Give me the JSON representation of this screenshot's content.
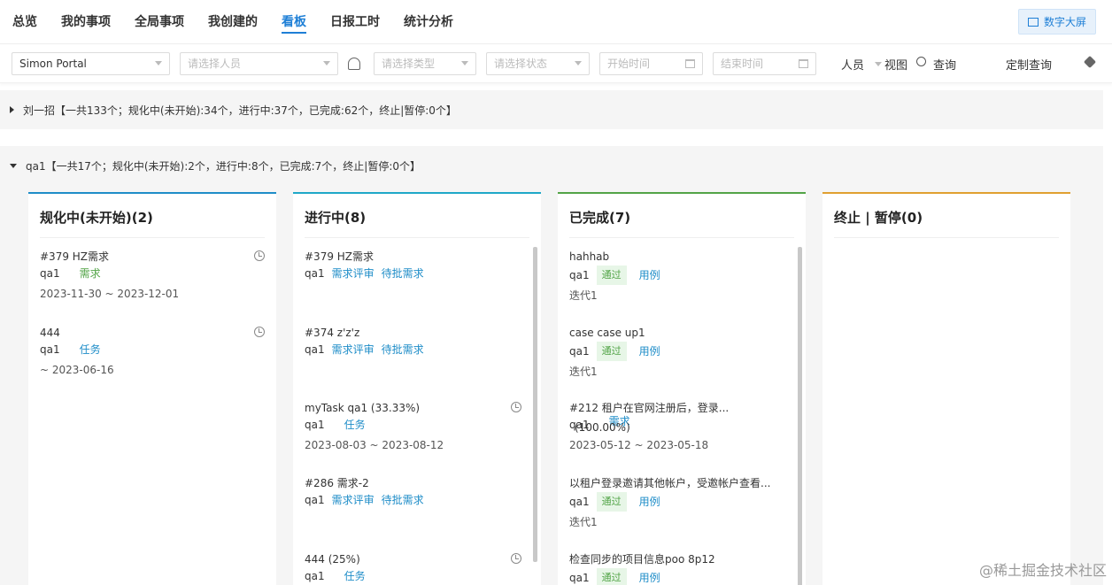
{
  "nav": {
    "tabs": [
      "总览",
      "我的事项",
      "全局事项",
      "我创建的",
      "看板",
      "日报工时",
      "统计分析"
    ],
    "big_screen": "数字大屏"
  },
  "filters": {
    "project": "Simon Portal",
    "person_placeholder": "请选择人员",
    "type_placeholder": "请选择类型",
    "status_placeholder": "请选择状态",
    "start_placeholder": "开始时间",
    "end_placeholder": "结束时间",
    "person_label": "人员",
    "view_label": "视图",
    "query_label": "查询",
    "custom_query": "定制查询"
  },
  "groups": [
    {
      "title": "刘一招【一共133个；规化中(未开始):34个，进行中:37个，已完成:62个，终止|暂停:0个】"
    },
    {
      "title": "qa1【一共17个；规化中(未开始):2个，进行中:8个，已完成:7个，终止|暂停:0个】"
    }
  ],
  "columns": [
    {
      "title": "规化中(未开始)(2)",
      "color": "#1f8dc8",
      "cards": [
        {
          "title": "#379 HZ需求",
          "owner": "qa1",
          "tags": [
            "需求"
          ],
          "date": "2023-11-30 ~ 2023-12-01",
          "clock": true
        },
        {
          "title": "444",
          "owner": "qa1",
          "tags": [
            "任务"
          ],
          "date": "~ 2023-06-16",
          "clock": true
        }
      ]
    },
    {
      "title": "进行中(8)",
      "color": "#1fa8c8",
      "cards": [
        {
          "title": "#379 HZ需求",
          "owner": "qa1",
          "tags": [
            "需求评审",
            "待批需求"
          ]
        },
        {
          "title": "#374 z'z'z",
          "owner": "qa1",
          "tags": [
            "需求评审",
            "待批需求"
          ]
        },
        {
          "title": "myTask qa1  (33.33%)",
          "owner": "qa1",
          "tags": [
            "任务"
          ],
          "date": "2023-08-03 ~ 2023-08-12",
          "clock": true
        },
        {
          "title": "#286 需求-2",
          "owner": "qa1",
          "tags": [
            "需求评审",
            "待批需求"
          ]
        },
        {
          "title": "444  (25%)",
          "owner": "qa1",
          "tags": [
            "任务"
          ],
          "clock": true
        }
      ]
    },
    {
      "title": "已完成(7)",
      "color": "#52a447",
      "cards": [
        {
          "title": "hahhab",
          "owner": "qa1",
          "badge": "通过",
          "tags": [
            "用例"
          ],
          "sub": "迭代1"
        },
        {
          "title": "case case up1",
          "owner": "qa1",
          "badge": "通过",
          "tags": [
            "用例"
          ],
          "sub": "迭代1"
        },
        {
          "title": "#212 租户在官网注册后，登录...",
          "owner": "qa1",
          "overlap": "(100.00%)",
          "tags": [
            "需求"
          ],
          "date": "2023-05-12 ~ 2023-05-18"
        },
        {
          "title": "以租户登录邀请其他帐户，受邀帐户查看...",
          "owner": "qa1",
          "badge": "通过",
          "tags": [
            "用例"
          ],
          "sub": "迭代1"
        },
        {
          "title": "检查同步的项目信息poo 8p12",
          "owner": "qa1",
          "badge": "通过",
          "tags": [
            "用例"
          ]
        }
      ]
    },
    {
      "title": "终止 | 暂停(0)",
      "color": "#e0a030",
      "cards": []
    }
  ],
  "watermark": "@稀土掘金技术社区"
}
